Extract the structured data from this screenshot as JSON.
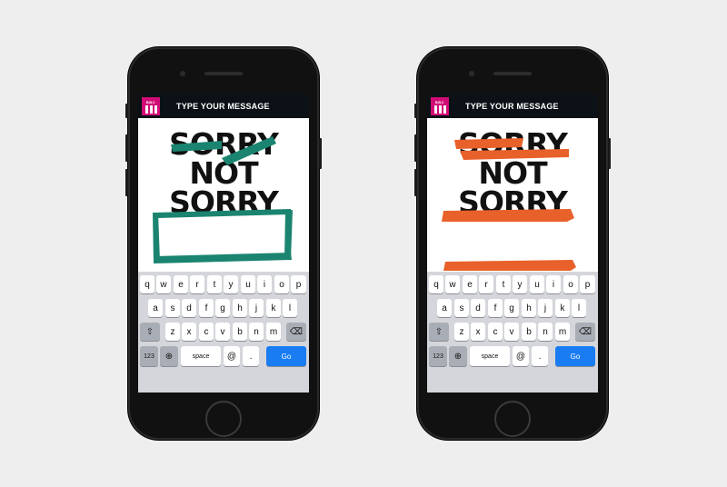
{
  "screens": [
    {
      "title": "TYPE YOUR MESSAGE",
      "logo_text": "BBC",
      "words": [
        "SORRY",
        "NOT",
        "SORRY"
      ],
      "accent": "#1a8470",
      "input_style": "box"
    },
    {
      "title": "TYPE YOUR MESSAGE",
      "logo_text": "BBC",
      "words": [
        "SORRY",
        "NOT",
        "SORRY"
      ],
      "accent": "#e8602a",
      "input_style": "lines"
    }
  ],
  "keyboard": {
    "row1": [
      "q",
      "w",
      "e",
      "r",
      "t",
      "y",
      "u",
      "i",
      "o",
      "p"
    ],
    "row2": [
      "a",
      "s",
      "d",
      "f",
      "g",
      "h",
      "j",
      "k",
      "l"
    ],
    "row3": [
      "z",
      "x",
      "c",
      "v",
      "b",
      "n",
      "m"
    ],
    "shift_icon": "⇧",
    "backspace_icon": "⌫",
    "numbers_label": "123",
    "globe_icon": "⊕",
    "space_label": "space",
    "at_label": "@",
    "dot_label": ".",
    "go_label": "Go"
  }
}
